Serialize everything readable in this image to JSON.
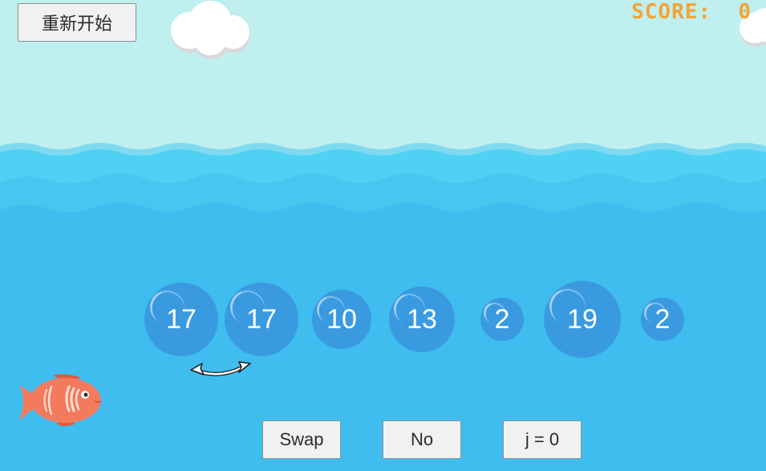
{
  "game": {
    "restart_label": "重新开始",
    "score_label": "SCORE:",
    "score_value": "0"
  },
  "bubbles": [
    {
      "value": "17"
    },
    {
      "value": "17"
    },
    {
      "value": "10"
    },
    {
      "value": "13"
    },
    {
      "value": "2"
    },
    {
      "value": "19"
    },
    {
      "value": "2"
    }
  ],
  "controls": {
    "swap_label": "Swap",
    "no_label": "No",
    "j_label": "j = 0"
  },
  "colors": {
    "sky": "#bff0ef",
    "sea": "#3ebdee",
    "bubble": "#3a9ae0",
    "score": "#f3a338",
    "fish": "#f47a5e"
  },
  "icons": {
    "cloud": "cloud-icon",
    "swap_arrow": "double-arrow-icon",
    "fish": "fish-icon"
  }
}
